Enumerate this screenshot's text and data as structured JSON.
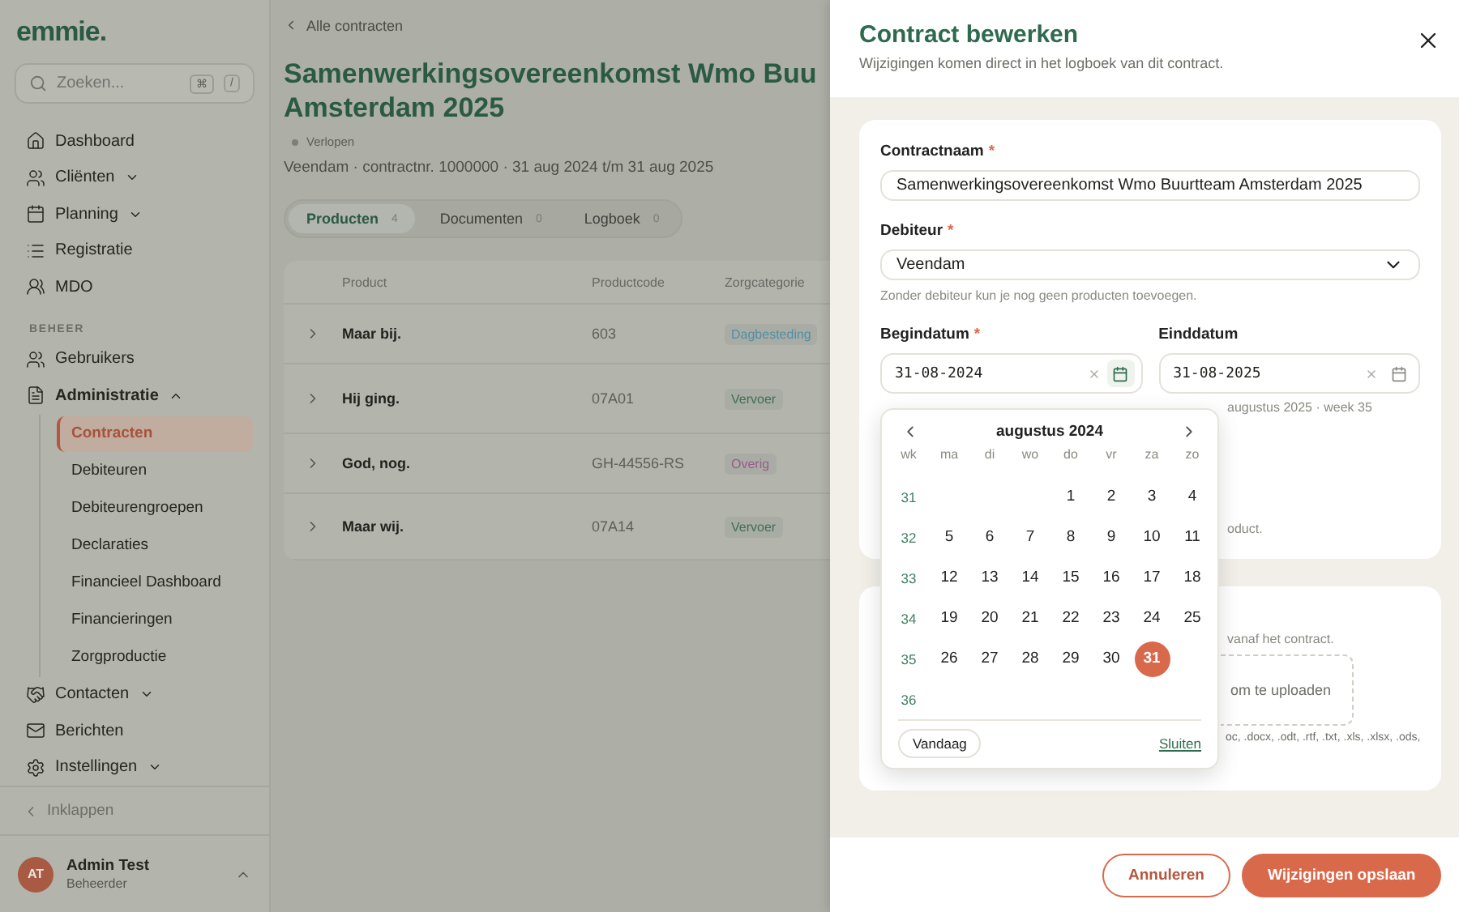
{
  "sidebar": {
    "logo": "emmie.",
    "search": {
      "placeholder": "Zoeken...",
      "keys": [
        "⌘",
        "/"
      ]
    },
    "nav": [
      {
        "kind": "home",
        "label": "Dashboard",
        "has_caret": false
      },
      {
        "kind": "clients",
        "label": "Cliënten",
        "has_caret": true
      },
      {
        "kind": "calendar",
        "label": "Planning",
        "has_caret": true
      },
      {
        "kind": "list",
        "label": "Registratie",
        "has_caret": false
      },
      {
        "kind": "group",
        "label": "MDO",
        "has_caret": false
      }
    ],
    "section_label": "BEHEER",
    "admin_nav": [
      {
        "kind": "users",
        "label": "Gebruikers",
        "has_caret": false,
        "expanded": false
      },
      {
        "kind": "file",
        "label": "Administratie",
        "has_caret": true,
        "expanded": true,
        "children": [
          {
            "label": "Contracten",
            "selected": true
          },
          {
            "label": "Debiteuren",
            "selected": false
          },
          {
            "label": "Debiteurengroepen",
            "selected": false
          },
          {
            "label": "Declaraties",
            "selected": false
          },
          {
            "label": "Financieel Dashboard",
            "selected": false
          },
          {
            "label": "Financieringen",
            "selected": false
          },
          {
            "label": "Zorgproductie",
            "selected": false
          }
        ]
      },
      {
        "kind": "handshake",
        "label": "Contacten",
        "has_caret": true,
        "expanded": false
      },
      {
        "kind": "mail",
        "label": "Berichten",
        "has_caret": false,
        "expanded": false
      },
      {
        "kind": "settings",
        "label": "Instellingen",
        "has_caret": true,
        "expanded": false
      }
    ],
    "collapse": "Inklappen",
    "user": {
      "initials": "AT",
      "name": "Admin Test",
      "role": "Beheerder"
    }
  },
  "main": {
    "back_link": "Alle contracten",
    "title_lines": [
      "Samenwerkingsovereenkomst Wmo Buu",
      "Amsterdam 2025"
    ],
    "status": "Verlopen",
    "meta": "Veendam · contractnr. 1000000 · 31 aug 2024 t/m 31 aug 2025",
    "tabs": [
      {
        "label": "Producten",
        "count": "4",
        "selected": true
      },
      {
        "label": "Documenten",
        "count": "0",
        "selected": false
      },
      {
        "label": "Logboek",
        "count": "0",
        "selected": false
      }
    ],
    "table": {
      "columns": [
        "Product",
        "Productcode",
        "Zorgcategorie"
      ],
      "rows": [
        {
          "product": "Maar bij.",
          "code": "603",
          "category": "Dagbesteding",
          "color": "#4f8fa6"
        },
        {
          "product": "Hij ging.",
          "code": "07A01",
          "category": "Vervoer",
          "color": "#3f6f55"
        },
        {
          "product": "God, nog.",
          "code": "GH-44556-RS",
          "category": "Overig",
          "color": "#9a5a8e"
        },
        {
          "product": "Maar wij.",
          "code": "07A14",
          "category": "Vervoer",
          "color": "#3f6f55"
        }
      ]
    }
  },
  "drawer": {
    "title": "Contract bewerken",
    "subtitle": "Wijzigingen komen direct in het logboek van dit contract.",
    "contract_name": {
      "label": "Contractnaam",
      "required_mark": "*",
      "value": "Samenwerkingsovereenkomst Wmo Buurtteam Amsterdam 2025"
    },
    "debtor": {
      "label": "Debiteur",
      "required_mark": "*",
      "value": "Veendam",
      "help": "Zonder debiteur kun je nog geen producten toevoegen."
    },
    "start_date": {
      "label": "Begindatum",
      "required_mark": "*",
      "value": "31-08-2024",
      "focused": true
    },
    "end_date": {
      "label": "Einddatum",
      "value": "31-08-2025",
      "focused": false
    },
    "date_help_fragment": "augustus 2025 · week 35",
    "product_help_fragment": "oduct.",
    "documents": {
      "help_fragment": "vanaf het contract.",
      "upload_fragment": "om te uploaden",
      "types_fragment": "oc, .docx, .odt, .rtf, .txt, .xls, .xlsx, .ods,"
    },
    "calendar": {
      "month": "augustus 2024",
      "weekdays": [
        "wk",
        "ma",
        "di",
        "wo",
        "do",
        "vr",
        "za",
        "zo"
      ],
      "weeks": [
        {
          "number": "31",
          "days": [
            {
              "label": "1",
              "selected": false
            },
            {
              "label": "2",
              "selected": false
            },
            {
              "label": "3",
              "selected": false
            },
            {
              "label": "4",
              "selected": false
            }
          ]
        },
        {
          "number": "32",
          "days": [
            {
              "label": "5",
              "selected": false
            },
            {
              "label": "6",
              "selected": false
            },
            {
              "label": "7",
              "selected": false
            },
            {
              "label": "8",
              "selected": false
            },
            {
              "label": "9",
              "selected": false
            },
            {
              "label": "10",
              "selected": false
            },
            {
              "label": "11",
              "selected": false
            }
          ]
        },
        {
          "number": "33",
          "days": [
            {
              "label": "12",
              "selected": false
            },
            {
              "label": "13",
              "selected": false
            },
            {
              "label": "14",
              "selected": false
            },
            {
              "label": "15",
              "selected": false
            },
            {
              "label": "16",
              "selected": false
            },
            {
              "label": "17",
              "selected": false
            },
            {
              "label": "18",
              "selected": false
            }
          ]
        },
        {
          "number": "34",
          "days": [
            {
              "label": "19",
              "selected": false
            },
            {
              "label": "20",
              "selected": false
            },
            {
              "label": "21",
              "selected": false
            },
            {
              "label": "22",
              "selected": false
            },
            {
              "label": "23",
              "selected": false
            },
            {
              "label": "24",
              "selected": false
            },
            {
              "label": "25",
              "selected": false
            }
          ]
        },
        {
          "number": "35",
          "days": [
            {
              "label": "26",
              "selected": false
            },
            {
              "label": "27",
              "selected": false
            },
            {
              "label": "28",
              "selected": false
            },
            {
              "label": "29",
              "selected": false
            },
            {
              "label": "30",
              "selected": false
            },
            {
              "label": "31",
              "selected": true
            }
          ]
        },
        {
          "number": "36"
        }
      ],
      "today_button": "Vandaag",
      "close_link": "Sluiten"
    },
    "buttons": {
      "cancel": "Annuleren",
      "save": "Wijzigingen opslaan"
    }
  }
}
